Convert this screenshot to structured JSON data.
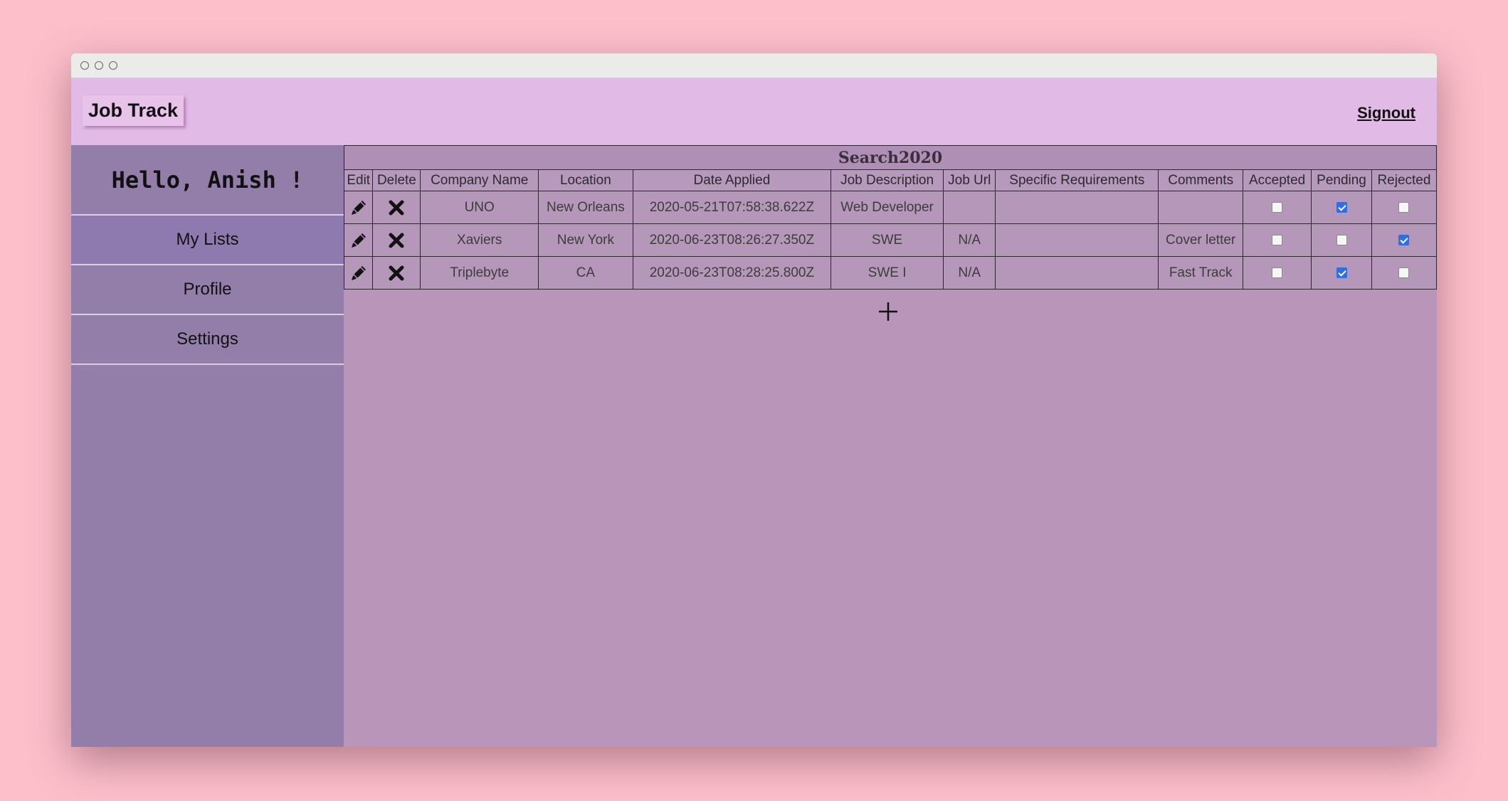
{
  "app": {
    "brand": "Job Track",
    "signout": "Signout"
  },
  "sidebar": {
    "greeting": "Hello, Anish !",
    "items": [
      {
        "label": "My Lists",
        "active": true
      },
      {
        "label": "Profile",
        "active": false
      },
      {
        "label": "Settings",
        "active": false
      }
    ]
  },
  "list": {
    "title": "Search2020",
    "columns": [
      "Edit",
      "Delete",
      "Company Name",
      "Location",
      "Date Applied",
      "Job Description",
      "Job Url",
      "Specific Requirements",
      "Comments",
      "Accepted",
      "Pending",
      "Rejected"
    ],
    "rows": [
      {
        "company": "UNO",
        "location": "New Orleans",
        "date": "2020-05-21T07:58:38.622Z",
        "description": "Web Developer",
        "url": "",
        "requirements": "",
        "comments": "",
        "accepted": false,
        "pending": true,
        "rejected": false
      },
      {
        "company": "Xaviers",
        "location": "New York",
        "date": "2020-06-23T08:26:27.350Z",
        "description": "SWE",
        "url": "N/A",
        "requirements": "",
        "comments": "Cover letter",
        "accepted": false,
        "pending": false,
        "rejected": true
      },
      {
        "company": "Triplebyte",
        "location": "CA",
        "date": "2020-06-23T08:28:25.800Z",
        "description": "SWE I",
        "url": "N/A",
        "requirements": "",
        "comments": "Fast Track",
        "accepted": false,
        "pending": true,
        "rejected": false
      }
    ]
  },
  "icons": {
    "edit": "pencil-icon",
    "delete": "close-icon",
    "add": "plus-icon"
  },
  "colors": {
    "background": "#fdc0cb",
    "topbar": "#e1bae6",
    "sidebar": "#937eaa",
    "content": "#b895b9",
    "checkbox_checked": "#2f6fe0"
  }
}
